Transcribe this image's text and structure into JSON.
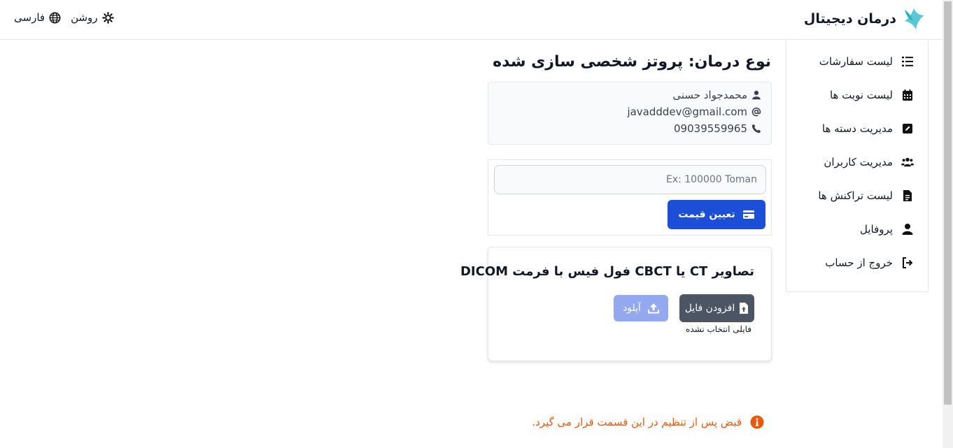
{
  "header": {
    "brand_name": "درمان دیجیتال",
    "language_label": "فارسی",
    "theme_label": "روشن"
  },
  "sidebar": {
    "items": [
      {
        "label": "لیست سفارشات",
        "icon": "list-icon"
      },
      {
        "label": "لیست نوبت ها",
        "icon": "calendar-icon"
      },
      {
        "label": "مدیریت دسته ها",
        "icon": "edit-icon"
      },
      {
        "label": "مدیریت کاربران",
        "icon": "users-icon"
      },
      {
        "label": "لیست تراکنش ها",
        "icon": "document-icon"
      },
      {
        "label": "پروفایل",
        "icon": "user-icon"
      },
      {
        "label": "خروج از حساب",
        "icon": "logout-icon"
      }
    ]
  },
  "main": {
    "title": "نوع درمان: پروتز شخصی سازی شده",
    "patient": {
      "name": "محمدجواد حسنی",
      "email": "javadddev@gmail.com",
      "phone": "09039559965"
    },
    "price": {
      "placeholder": "Ex: 100000 Toman",
      "button_label": "تعیین قیمت"
    },
    "upload": {
      "title": "تصاویر CT یا CBCT فول فیس با فرمت DICOM",
      "add_file_label": "افزودن فایل",
      "upload_label": "آپلود",
      "no_file_text": "فایلی انتخاب نشده"
    },
    "notice": "قبض پس از تنظیم در این قسمت قرار می گیرد."
  },
  "colors": {
    "primary": "#1d4ed8",
    "upload_disabled": "#93a8ef",
    "dark_button": "#4b5563",
    "notice": "#ea580c",
    "logo": "#5bc8d6"
  }
}
